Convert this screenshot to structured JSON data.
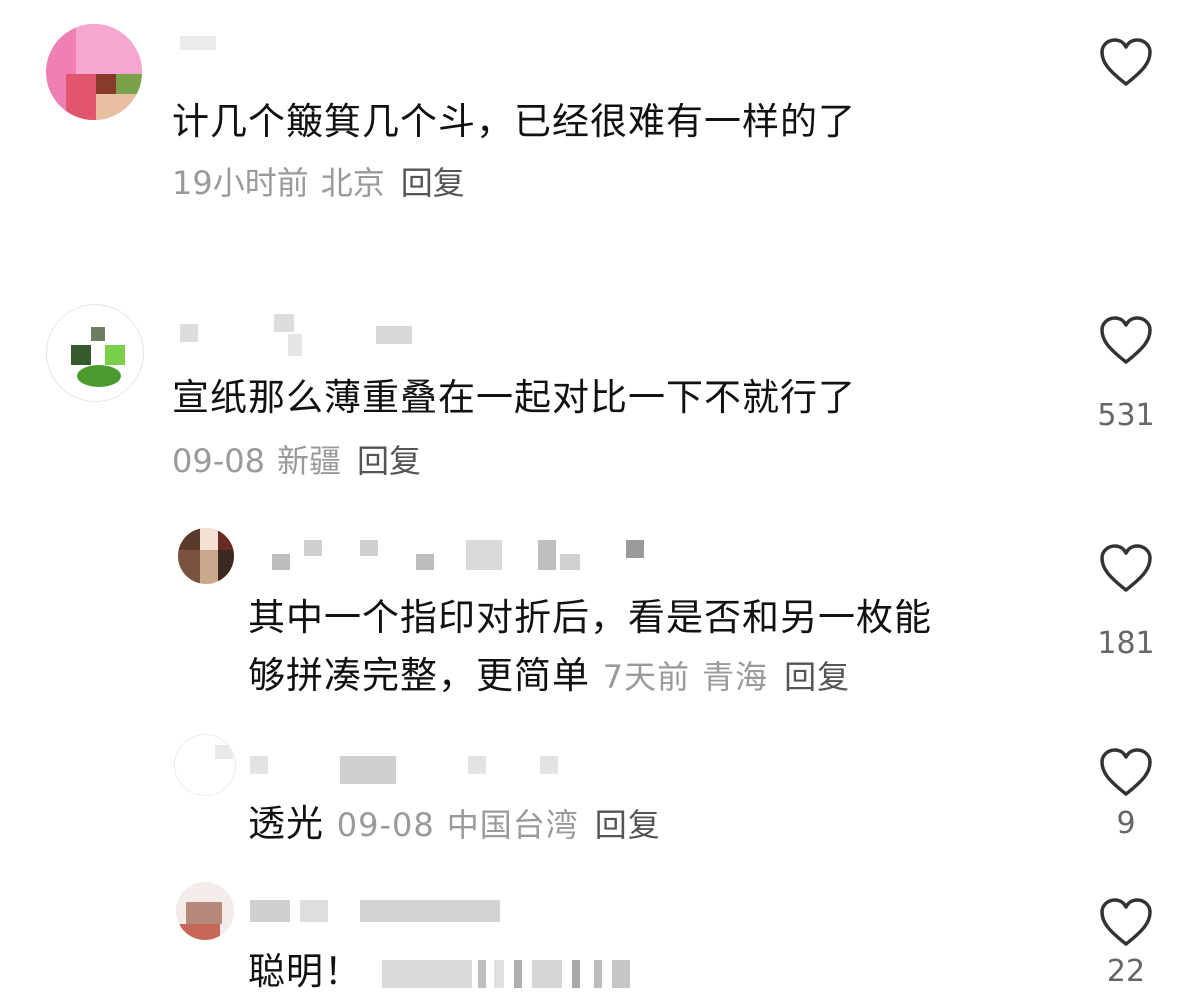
{
  "comments": [
    {
      "text": "计几个簸箕几个斗，已经很难有一样的了",
      "time": "19小时前",
      "location": "北京",
      "reply": "回复",
      "likes": ""
    },
    {
      "text": "宣纸那么薄重叠在一起对比一下不就行了",
      "time": "09-08",
      "location": "新疆",
      "reply": "回复",
      "likes": "531"
    },
    {
      "text_line1": "其中一个指印对折后，看是否和另一枚能",
      "text_line2": "够拼凑完整，更简单",
      "time": "7天前",
      "location": "青海",
      "reply": "回复",
      "likes": "181"
    },
    {
      "text": "透光",
      "time": "09-08",
      "location": "中国台湾",
      "reply": "回复",
      "likes": "9"
    },
    {
      "text": "聪明！",
      "likes": "22"
    }
  ],
  "icons": {
    "like": "heart-outline-icon"
  },
  "colors": {
    "text": "#111111",
    "meta": "#9a9a9a",
    "reply": "#555555",
    "icon": "#333333"
  }
}
